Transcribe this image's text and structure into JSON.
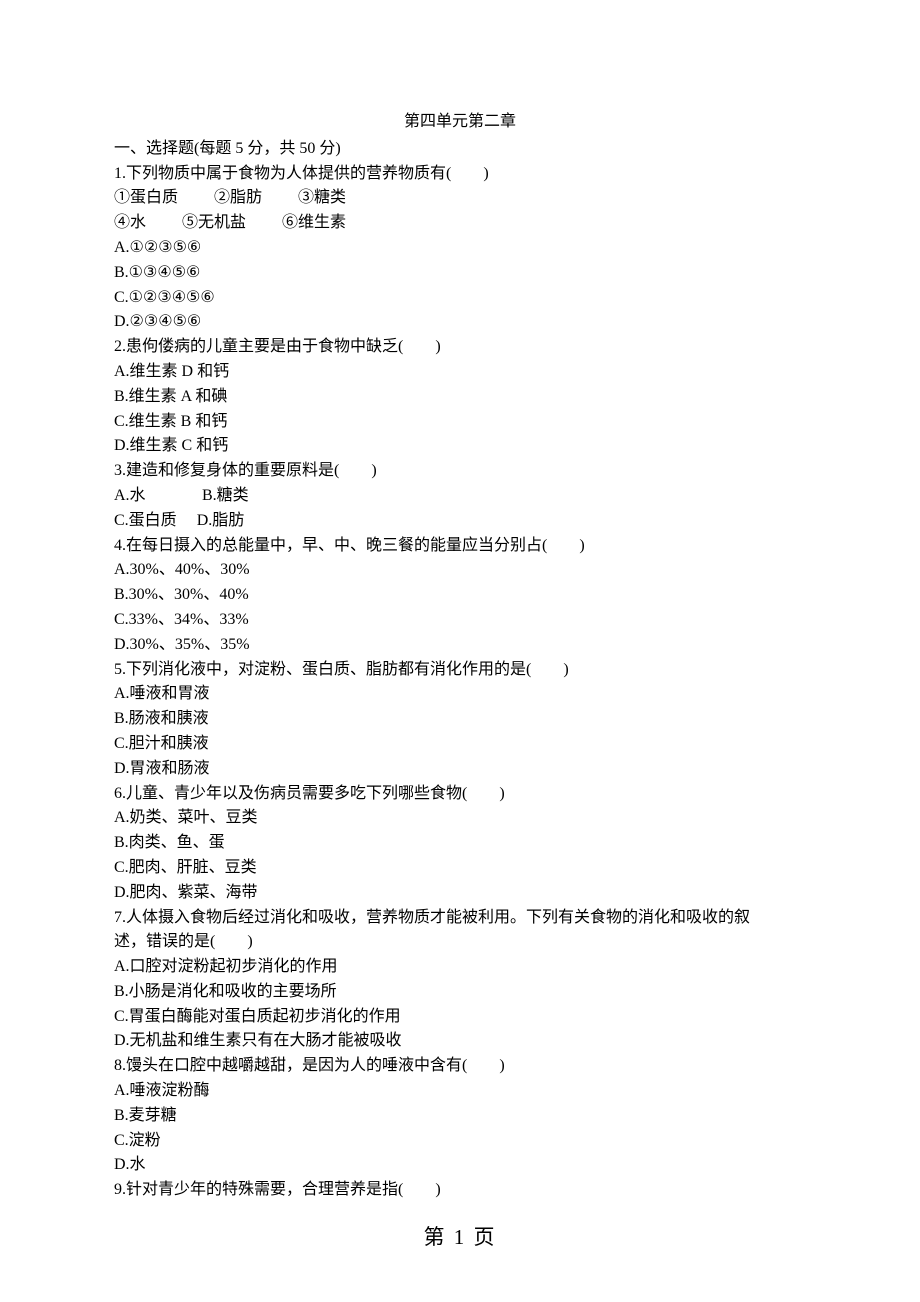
{
  "title": "第四单元第二章",
  "section_heading": "一、选择题(每题 5 分，共 50 分)",
  "q1": {
    "stem": "1.下列物质中属于食物为人体提供的营养物质有(　　)",
    "line1_a": "①蛋白质",
    "line1_b": "②脂肪",
    "line1_c": "③糖类",
    "line2_a": "④水",
    "line2_b": "⑤无机盐",
    "line2_c": "⑥维生素",
    "optA": "A.①②③⑤⑥",
    "optB": "B.①③④⑤⑥",
    "optC": "C.①②③④⑤⑥",
    "optD": "D.②③④⑤⑥"
  },
  "q2": {
    "stem": "2.患佝偻病的儿童主要是由于食物中缺乏(　　)",
    "optA": "A.维生素 D 和钙",
    "optB": "B.维生素 A 和碘",
    "optC": "C.维生素 B 和钙",
    "optD": "D.维生素 C 和钙"
  },
  "q3": {
    "stem": "3.建造和修复身体的重要原料是(　　)",
    "optA": "A.水",
    "optB": "B.糖类",
    "optC": "C.蛋白质",
    "optD": "D.脂肪"
  },
  "q4": {
    "stem": "4.在每日摄入的总能量中，早、中、晚三餐的能量应当分别占(　　)",
    "optA": "A.30%、40%、30%",
    "optB": "B.30%、30%、40%",
    "optC": "C.33%、34%、33%",
    "optD": "D.30%、35%、35%"
  },
  "q5": {
    "stem": "5.下列消化液中，对淀粉、蛋白质、脂肪都有消化作用的是(　　)",
    "optA": "A.唾液和胃液",
    "optB": "B.肠液和胰液",
    "optC": "C.胆汁和胰液",
    "optD": "D.胃液和肠液"
  },
  "q6": {
    "stem": "6.儿童、青少年以及伤病员需要多吃下列哪些食物(　　)",
    "optA": "A.奶类、菜叶、豆类",
    "optB": "B.肉类、鱼、蛋",
    "optC": "C.肥肉、肝脏、豆类",
    "optD": "D.肥肉、紫菜、海带"
  },
  "q7": {
    "stem_line1": "7.人体摄入食物后经过消化和吸收，营养物质才能被利用。下列有关食物的消化和吸收的叙",
    "stem_line2": "述，错误的是(　　)",
    "optA": "A.口腔对淀粉起初步消化的作用",
    "optB": "B.小肠是消化和吸收的主要场所",
    "optC": "C.胃蛋白酶能对蛋白质起初步消化的作用",
    "optD": "D.无机盐和维生素只有在大肠才能被吸收"
  },
  "q8": {
    "stem": "8.馒头在口腔中越嚼越甜，是因为人的唾液中含有(　　)",
    "optA": "A.唾液淀粉酶",
    "optB": "B.麦芽糖",
    "optC": "C.淀粉",
    "optD": "D.水"
  },
  "q9": {
    "stem": "9.针对青少年的特殊需要，合理营养是指(　　)"
  },
  "page_number": "第 1 页"
}
